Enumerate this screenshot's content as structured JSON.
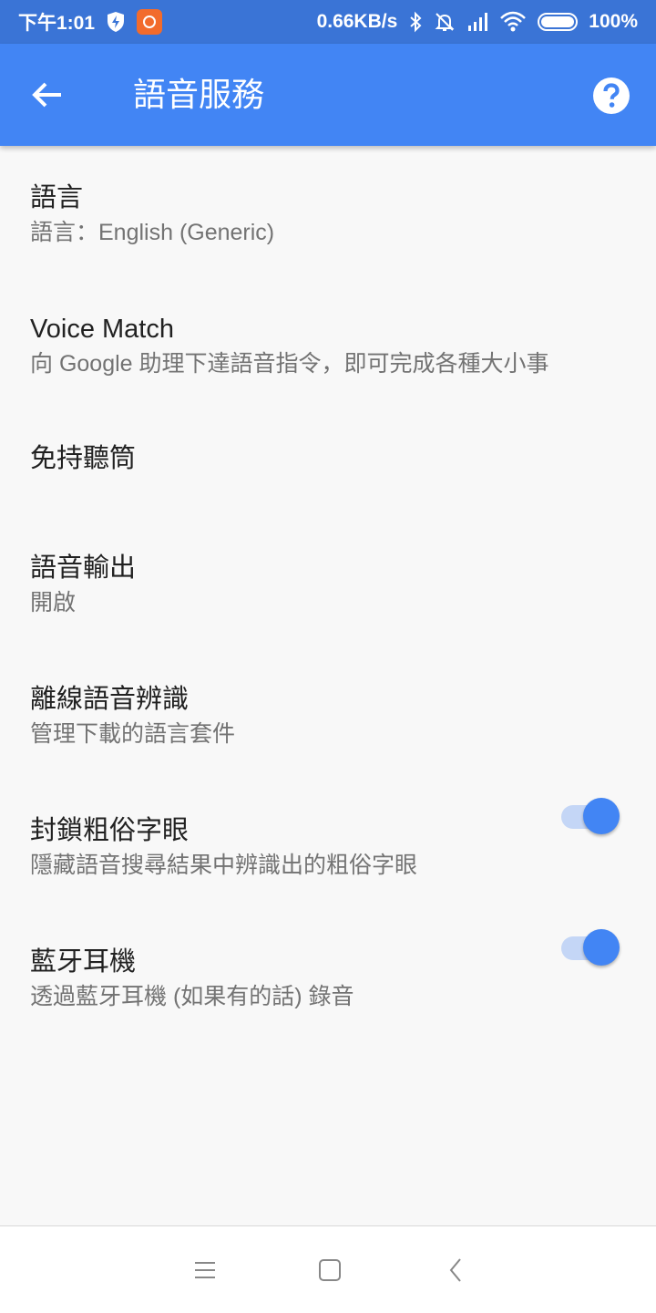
{
  "status_bar": {
    "time": "下午1:01",
    "network_speed": "0.66KB/s",
    "battery_percent": "100%",
    "battery_level": 1.0,
    "icons": [
      "shield-bolt-icon",
      "app-badge-icon",
      "bluetooth-icon",
      "bell-off-icon",
      "signal-icon",
      "wifi-icon",
      "battery-icon"
    ]
  },
  "app_bar": {
    "title": "語音服務",
    "back_icon": "arrow-left-icon",
    "help_icon": "help-circle-icon",
    "background_color": "#4285f4"
  },
  "settings": {
    "items": [
      {
        "title": "語言",
        "subtitle": "語言：English (Generic)"
      },
      {
        "title": "Voice Match",
        "subtitle": "向 Google 助理下達語音指令，即可完成各種大小事"
      },
      {
        "title": "免持聽筒",
        "subtitle": ""
      },
      {
        "title": "語音輸出",
        "subtitle": "開啟"
      },
      {
        "title": "離線語音辨識",
        "subtitle": "管理下載的語言套件"
      },
      {
        "title": "封鎖粗俗字眼",
        "subtitle": "隱藏語音搜尋結果中辨識出的粗俗字眼",
        "toggle_on": true
      },
      {
        "title": "藍牙耳機",
        "subtitle": "透過藍牙耳機 (如果有的話) 錄音",
        "toggle_on": true
      }
    ]
  },
  "colors": {
    "accent": "#4285f4",
    "status_bar": "#3a74d6",
    "toggle_track": "#c4d6f6"
  },
  "nav_bar": {
    "icons": [
      "menu-icon",
      "home-square-icon",
      "back-chevron-icon"
    ]
  }
}
